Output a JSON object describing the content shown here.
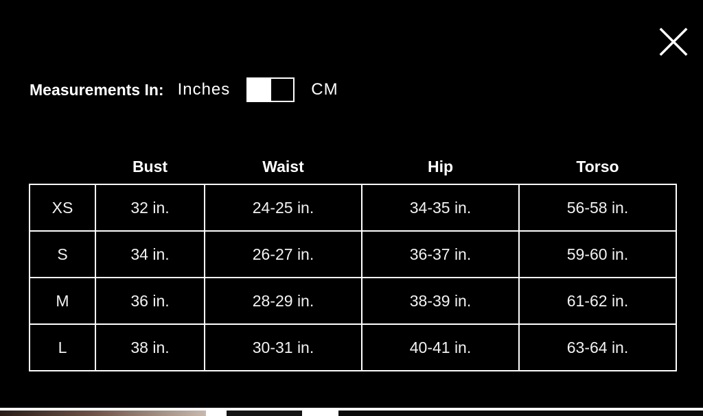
{
  "close_icon": "close-x-icon",
  "measurement": {
    "title": "Measurements In:",
    "option_inches": "Inches",
    "option_cm": "CM",
    "selected": "Inches"
  },
  "table": {
    "headers": [
      "",
      "Bust",
      "Waist",
      "Hip",
      "Torso"
    ],
    "rows": [
      [
        "XS",
        "32 in.",
        "24-25 in.",
        "34-35 in.",
        "56-58 in."
      ],
      [
        "S",
        "34 in.",
        "26-27 in.",
        "36-37 in.",
        "59-60 in."
      ],
      [
        "M",
        "36 in.",
        "28-29 in.",
        "38-39 in.",
        "61-62 in."
      ],
      [
        "L",
        "38 in.",
        "30-31 in.",
        "40-41 in.",
        "63-64 in."
      ]
    ]
  },
  "colors": {
    "background": "#000000",
    "foreground": "#ffffff"
  }
}
